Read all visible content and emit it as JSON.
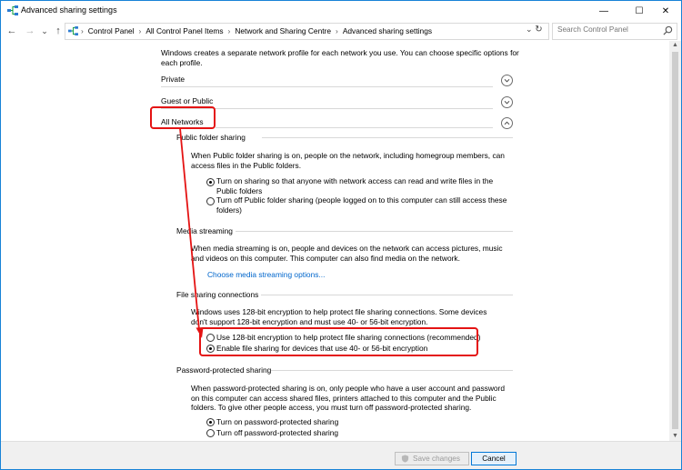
{
  "window": {
    "title": "Advanced sharing settings",
    "controls": {
      "minimize": "—",
      "maximize": "☐",
      "close": "✕"
    }
  },
  "nav": {
    "back": "←",
    "forward": "→",
    "dropdown": "⌄",
    "up": "↑",
    "refresh": "↻"
  },
  "address": {
    "crumbs": [
      "Control Panel",
      "All Control Panel Items",
      "Network and Sharing Centre",
      "Advanced sharing settings"
    ],
    "separator": "›",
    "dropdown": "⌄"
  },
  "search": {
    "placeholder": "Search Control Panel"
  },
  "intro": "Windows creates a separate network profile for each network you use. You can choose specific options for each profile.",
  "profiles": {
    "private": "Private",
    "guest": "Guest or Public",
    "all": "All Networks"
  },
  "public_folder": {
    "heading": "Public folder sharing",
    "desc": "When Public folder sharing is on, people on the network, including homegroup members, can access files in the Public folders.",
    "opt_on": "Turn on sharing so that anyone with network access can read and write files in the Public folders",
    "opt_off": "Turn off Public folder sharing (people logged on to this computer can still access these folders)"
  },
  "media": {
    "heading": "Media streaming",
    "desc": "When media streaming is on, people and devices on the network can access pictures, music and videos on this computer. This computer can also find media on the network.",
    "link": "Choose media streaming options..."
  },
  "file_sharing": {
    "heading": "File sharing connections",
    "desc": "Windows uses 128-bit encryption to help protect file sharing connections. Some devices don't support 128-bit encryption and must use 40- or 56-bit encryption.",
    "opt_128": "Use 128-bit encryption to help protect file sharing connections (recommended)",
    "opt_40": "Enable file sharing for devices that use 40- or 56-bit encryption"
  },
  "password": {
    "heading": "Password-protected sharing",
    "desc": "When password-protected sharing is on, only people who have a user account and password on this computer can access shared files, printers attached to this computer and the Public folders. To give other people access, you must turn off password-protected sharing.",
    "opt_on": "Turn on password-protected sharing",
    "opt_off": "Turn off password-protected sharing"
  },
  "footer": {
    "save": "Save changes",
    "cancel": "Cancel"
  },
  "colors": {
    "accent": "#0078d7",
    "annotation": "#e41313",
    "link": "#0066cc"
  }
}
